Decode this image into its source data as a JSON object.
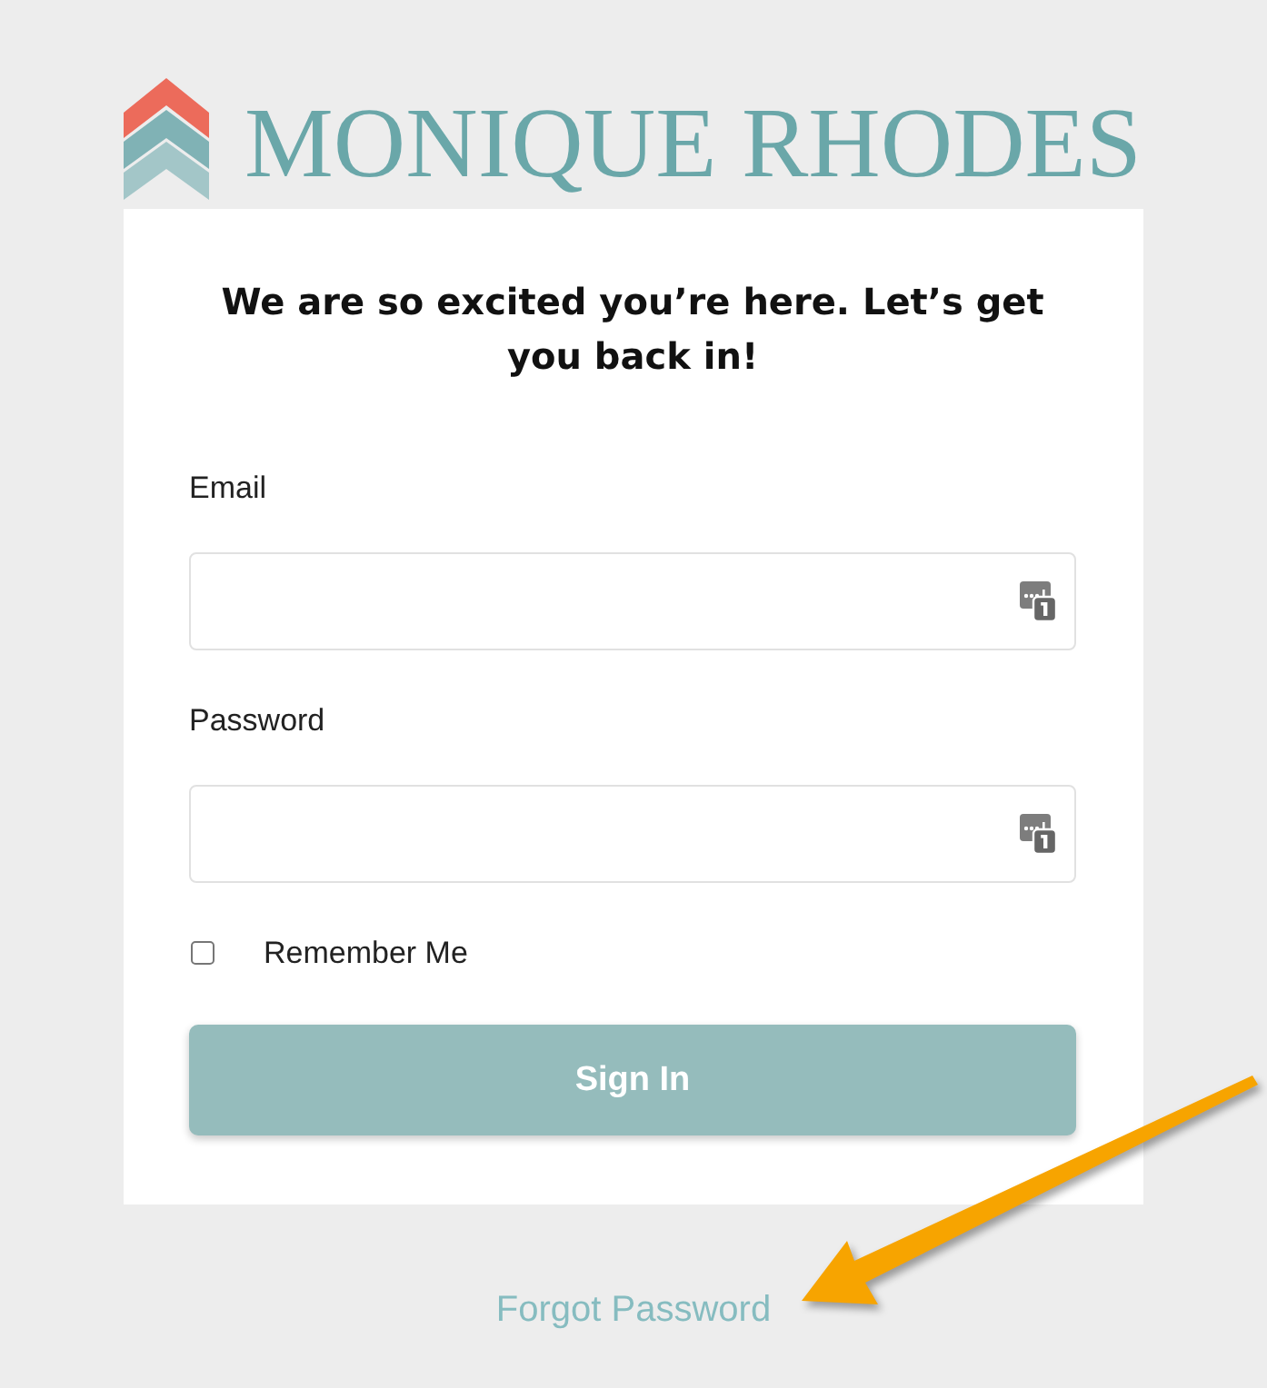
{
  "logo": {
    "text": "MONIQUE RHODES"
  },
  "heading": "We are so excited you’re here. Let’s get you back in!",
  "fields": [
    {
      "label": "Email"
    },
    {
      "label": "Password"
    }
  ],
  "remember_me": {
    "label": "Remember Me",
    "checked": false
  },
  "sign_in_button": {
    "label": "Sign In"
  },
  "forgot_password_link": {
    "label": "Forgot Password"
  }
}
